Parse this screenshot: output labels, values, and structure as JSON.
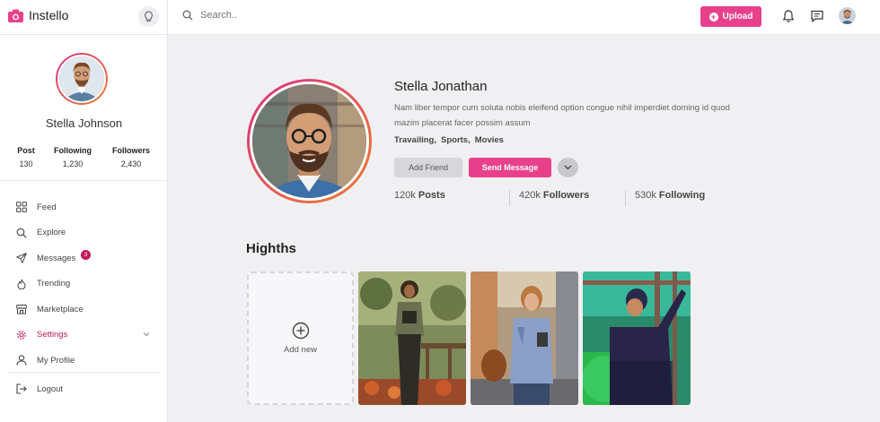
{
  "app": {
    "name": "Instello"
  },
  "search": {
    "placeholder": "Search.."
  },
  "topbar": {
    "upload_label": "Upload"
  },
  "sidebar": {
    "user_name": "Stella Johnson",
    "stats": [
      {
        "label": "Post",
        "value": "130"
      },
      {
        "label": "Following",
        "value": "1,230"
      },
      {
        "label": "Followers",
        "value": "2,430"
      }
    ],
    "nav": [
      {
        "label": "Feed",
        "icon": "grid-icon"
      },
      {
        "label": "Explore",
        "icon": "search-icon"
      },
      {
        "label": "Messages",
        "icon": "send-icon",
        "badge": "3"
      },
      {
        "label": "Trending",
        "icon": "fire-icon"
      },
      {
        "label": "Marketplace",
        "icon": "store-icon"
      },
      {
        "label": "Settings",
        "icon": "gear-icon",
        "active": true
      },
      {
        "label": "My Profile",
        "icon": "user-icon"
      }
    ],
    "logout_label": "Logout"
  },
  "profile": {
    "name": "Stella Jonathan",
    "bio": "Nam liber tempor cum soluta nobis eleifend option congue nihil imperdiet doming id quod mazim placerat facer possim assum",
    "tags": [
      "Travailing,",
      "Sports,",
      "Movies"
    ],
    "add_friend_label": "Add Friend",
    "send_message_label": "Send Message",
    "counts": [
      {
        "value": "120k",
        "label": "Posts"
      },
      {
        "value": "420k",
        "label": "Followers"
      },
      {
        "value": "530k",
        "label": "Following"
      }
    ]
  },
  "highlights": {
    "title": "Highths",
    "add_new_label": "Add new"
  },
  "colors": {
    "accent": "#e8408a",
    "active": "#c2185b"
  }
}
